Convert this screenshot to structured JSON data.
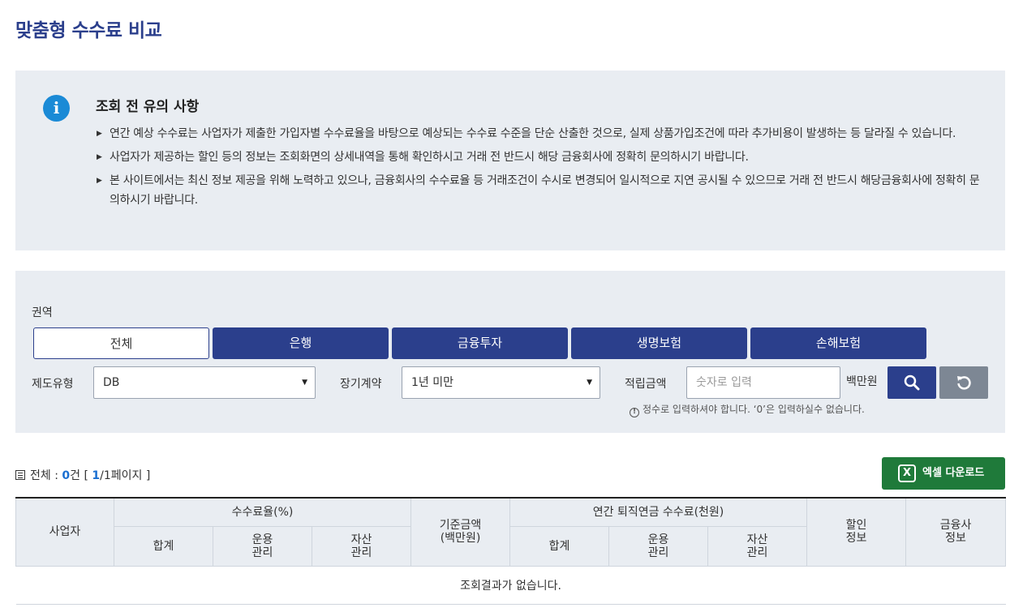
{
  "page": {
    "title": "맞춤형 수수료 비교"
  },
  "notice": {
    "heading": "조회 전 유의 사항",
    "icon": "info-icon",
    "items": [
      "연간 예상 수수료는 사업자가 제출한 가입자별 수수료율을 바탕으로 예상되는 수수료 수준을 단순 산출한 것으로, 실제 상품가입조건에 따라 추가비용이 발생하는 등 달라질 수 있습니다.",
      "사업자가 제공하는 할인 등의 정보는 조회화면의 상세내역을 통해 확인하시고 거래 전 반드시 해당 금융회사에 정확히 문의하시기 바랍니다.",
      "본 사이트에서는 최신 정보 제공을 위해 노력하고 있으나, 금융회사의 수수료율 등 거래조건이 수시로 변경되어 일시적으로 지연 공시될 수 있으므로 거래 전 반드시 해당금융회사에 정확히 문의하시기 바랍니다."
    ]
  },
  "search": {
    "region_label": "권역",
    "tabs": [
      {
        "label": "전체",
        "active": true
      },
      {
        "label": "은행",
        "active": false
      },
      {
        "label": "금융투자",
        "active": false
      },
      {
        "label": "생명보험",
        "active": false
      },
      {
        "label": "손해보험",
        "active": false
      }
    ],
    "plan_type_label": "제도유형",
    "plan_type_value": "DB",
    "long_term_label": "장기계약",
    "long_term_value": "1년 미만",
    "amount_label": "적립금액",
    "amount_placeholder": "숫자로 입력",
    "amount_unit": "백만원",
    "hint": "정수로 입력하셔야 합니다. ‘0’은 입력하실수 없습니다.",
    "hint_icon": "!"
  },
  "summary": {
    "prefix": "전체 : ",
    "count": "0",
    "count_suffix": "건 [ ",
    "current_page": "1",
    "page_suffix": "/1페이지 ]"
  },
  "excel_button": {
    "label": "엑셀 다운로드",
    "icon": "X"
  },
  "table": {
    "col_company": "사업자",
    "group_rate": "수수료율(%)",
    "rate_total": "합계",
    "rate_ops_1": "운용",
    "rate_ops_2": "관리",
    "rate_asset_1": "자산",
    "rate_asset_2": "관리",
    "base_amount_1": "기준금액",
    "base_amount_2": "(백만원)",
    "group_fee": "연간 퇴직연금 수수료(천원)",
    "fee_total": "합계",
    "fee_ops_1": "운용",
    "fee_ops_2": "관리",
    "fee_asset_1": "자산",
    "fee_asset_2": "관리",
    "discount_1": "할인",
    "discount_2": "정보",
    "company_info_1": "금융사",
    "company_info_2": "정보",
    "empty_message": "조회결과가 없습니다."
  },
  "colors": {
    "title": "#2b3f8c",
    "tab_inactive": "#2b3f8c",
    "panel_bg": "#e9edf2",
    "excel": "#1f7a3a",
    "info_icon": "#1a8ad6"
  }
}
